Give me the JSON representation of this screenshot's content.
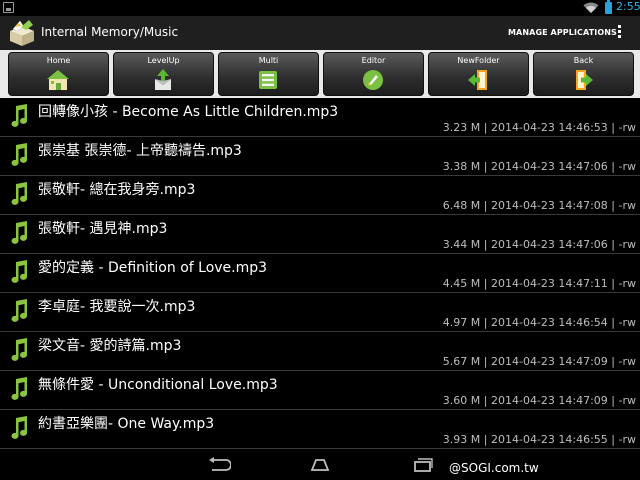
{
  "status_bar": {
    "time": "2:55",
    "colors": {
      "time": "#33b5e5",
      "battery": "#2aa1d8"
    }
  },
  "action_bar": {
    "title": "Internal Memory/Music",
    "manage_label": "MANAGE APPLICATIONS",
    "app_icon": "file-manager-box-icon",
    "overflow_icon": "overflow-menu-icon"
  },
  "toolbar": {
    "buttons": [
      {
        "label": "Home",
        "icon": "home-icon"
      },
      {
        "label": "LevelUp",
        "icon": "level-up-icon"
      },
      {
        "label": "Multi",
        "icon": "multi-select-icon"
      },
      {
        "label": "Editor",
        "icon": "editor-icon"
      },
      {
        "label": "NewFolder",
        "icon": "new-folder-icon"
      },
      {
        "label": "Back",
        "icon": "back-icon"
      }
    ]
  },
  "files": [
    {
      "name": "回轉像小孩 - Become As Little Children.mp3",
      "meta": "3.23 M | 2014-04-23 14:46:53 | -rw"
    },
    {
      "name": "張崇基 張崇德- 上帝聽禱告.mp3",
      "meta": "3.38 M | 2014-04-23 14:47:06 | -rw"
    },
    {
      "name": "張敬軒- 總在我身旁.mp3",
      "meta": "6.48 M | 2014-04-23 14:47:08 | -rw"
    },
    {
      "name": "張敬軒- 遇見神.mp3",
      "meta": "3.44 M | 2014-04-23 14:47:06 | -rw"
    },
    {
      "name": "愛的定義 - Definition of Love.mp3",
      "meta": "4.45 M | 2014-04-23 14:47:11 | -rw"
    },
    {
      "name": "李卓庭- 我要說一次.mp3",
      "meta": "4.97 M | 2014-04-23 14:46:54 | -rw"
    },
    {
      "name": "梁文音- 愛的詩篇.mp3",
      "meta": "5.67 M | 2014-04-23 14:47:09 | -rw"
    },
    {
      "name": "無條件愛 - Unconditional Love.mp3",
      "meta": "3.60 M | 2014-04-23 14:47:09 | -rw"
    },
    {
      "name": "約書亞樂團- One Way.mp3",
      "meta": "3.93 M | 2014-04-23 14:46:55 | -rw"
    }
  ],
  "file_icon": "music-note-icon",
  "nav_bar": {
    "buttons": [
      "back-nav-icon",
      "home-nav-icon",
      "recent-apps-icon"
    ]
  },
  "watermark": "@SOGI.com.tw",
  "colors": {
    "music_note": "#8bc53f",
    "toolbar_bg": "#e9e9e9",
    "row_divider": "#3a3a3a",
    "meta_text": "#bdbdbd"
  }
}
